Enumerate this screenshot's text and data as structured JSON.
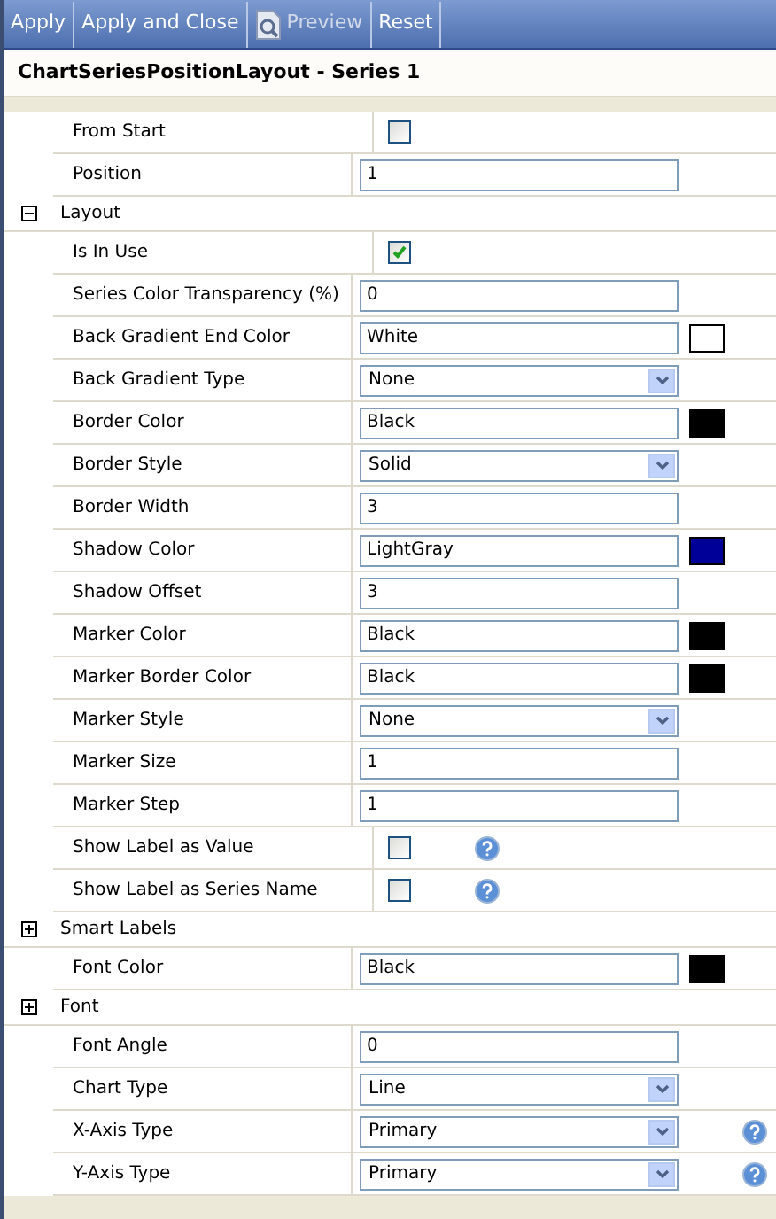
{
  "toolbar": [
    {
      "label": "Apply",
      "disabled": false,
      "icon": false
    },
    {
      "label": "Apply and Close",
      "disabled": false,
      "icon": false
    },
    {
      "label": "Preview",
      "disabled": true,
      "icon": true
    },
    {
      "label": "Reset",
      "disabled": false,
      "icon": false
    }
  ],
  "title": "ChartSeriesPositionLayout - Series 1",
  "rows": [
    {
      "kind": "checkbox",
      "label": "From Start",
      "checked": false,
      "help": false
    },
    {
      "kind": "text",
      "label": "Position",
      "value": "1",
      "help": false
    },
    {
      "kind": "section",
      "label": "Layout",
      "expanded": true
    },
    {
      "kind": "checkbox",
      "label": "Is In Use",
      "checked": true,
      "help": false
    },
    {
      "kind": "text",
      "label": "Series Color Transparency (%)",
      "value": "0",
      "help": false
    },
    {
      "kind": "text",
      "label": "Back Gradient End Color",
      "value": "White",
      "color": "#ffffff",
      "help": false
    },
    {
      "kind": "select",
      "label": "Back Gradient Type",
      "value": "None",
      "help": false
    },
    {
      "kind": "text",
      "label": "Border Color",
      "value": "Black",
      "color": "#000000",
      "help": false
    },
    {
      "kind": "select",
      "label": "Border Style",
      "value": "Solid",
      "help": false
    },
    {
      "kind": "text",
      "label": "Border Width",
      "value": "3",
      "help": false
    },
    {
      "kind": "text",
      "label": "Shadow Color",
      "value": "LightGray",
      "color": "#000099",
      "help": false
    },
    {
      "kind": "text",
      "label": "Shadow Offset",
      "value": "3",
      "help": false
    },
    {
      "kind": "text",
      "label": "Marker Color",
      "value": "Black",
      "color": "#000000",
      "help": false
    },
    {
      "kind": "text",
      "label": "Marker Border Color",
      "value": "Black",
      "color": "#000000",
      "help": false
    },
    {
      "kind": "select",
      "label": "Marker Style",
      "value": "None",
      "help": false
    },
    {
      "kind": "text",
      "label": "Marker Size",
      "value": "1",
      "help": false
    },
    {
      "kind": "text",
      "label": "Marker Step",
      "value": "1",
      "help": false
    },
    {
      "kind": "checkbox",
      "label": "Show Label as Value",
      "checked": false,
      "help": true
    },
    {
      "kind": "checkbox",
      "label": "Show Label as Series Name",
      "checked": false,
      "help": true
    },
    {
      "kind": "section",
      "label": "Smart Labels",
      "expanded": false
    },
    {
      "kind": "text",
      "label": "Font Color",
      "value": "Black",
      "color": "#000000",
      "help": false
    },
    {
      "kind": "section",
      "label": "Font",
      "expanded": false
    },
    {
      "kind": "text",
      "label": "Font Angle",
      "value": "0",
      "help": false
    },
    {
      "kind": "select",
      "label": "Chart Type",
      "value": "Line",
      "help": false
    },
    {
      "kind": "select",
      "label": "X-Axis Type",
      "value": "Primary",
      "help": true
    },
    {
      "kind": "select",
      "label": "Y-Axis Type",
      "value": "Primary",
      "help": true
    }
  ]
}
